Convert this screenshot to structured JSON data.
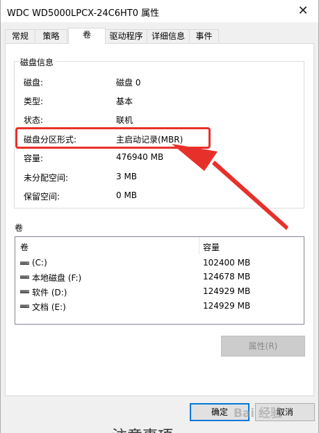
{
  "window": {
    "title": "WDC WD5000LPCX-24C6HT0 属性",
    "close_glyph": "✕"
  },
  "tabs": [
    {
      "label": "常规"
    },
    {
      "label": "策略"
    },
    {
      "label": "卷"
    },
    {
      "label": "驱动程序"
    },
    {
      "label": "详细信息"
    },
    {
      "label": "事件"
    }
  ],
  "active_tab": "卷",
  "disk_info": {
    "title": "磁盘信息",
    "rows": [
      {
        "label": "磁盘:",
        "value": "磁盘 0"
      },
      {
        "label": "类型:",
        "value": "基本"
      },
      {
        "label": "状态:",
        "value": "联机"
      },
      {
        "label": "磁盘分区形式:",
        "value": "主启动记录(MBR)"
      },
      {
        "label": "容量:",
        "value": "476940 MB"
      },
      {
        "label": "未分配空间:",
        "value": "3 MB"
      },
      {
        "label": "保留空间:",
        "value": "0 MB"
      }
    ]
  },
  "volumes": {
    "section_label": "卷",
    "columns": [
      "卷",
      "容量"
    ],
    "rows": [
      {
        "name": "(C:)",
        "capacity": "102400 MB",
        "icon": "drive-icon"
      },
      {
        "name": "本地磁盘 (F:)",
        "capacity": "124678 MB",
        "icon": "drive-icon"
      },
      {
        "name": "软件 (D:)",
        "capacity": "124929 MB",
        "icon": "drive-icon"
      },
      {
        "name": "文档 (E:)",
        "capacity": "124929 MB",
        "icon": "drive-icon"
      }
    ]
  },
  "buttons": {
    "properties": "属性(R)",
    "ok": "确定",
    "cancel": "取消"
  },
  "overlay": {
    "watermark": "Bai 经验",
    "bottom_text": "注意事项",
    "highlight_color": "#e8302a"
  }
}
